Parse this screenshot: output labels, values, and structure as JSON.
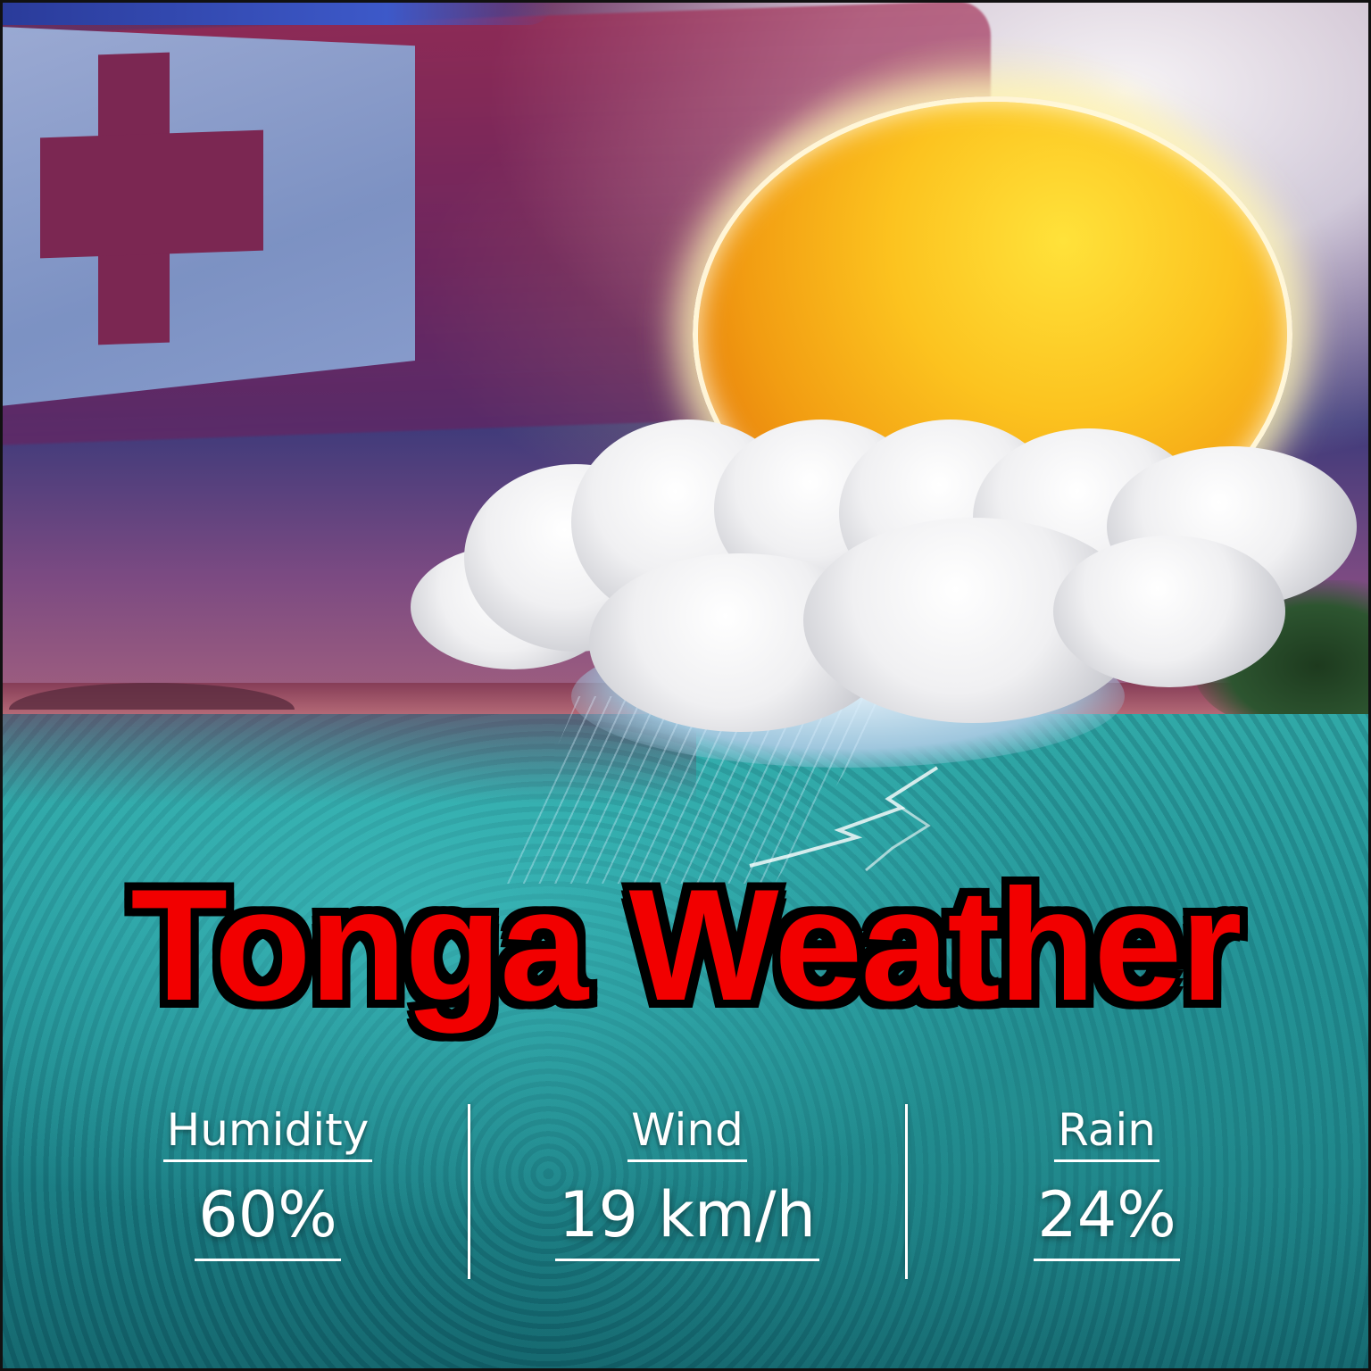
{
  "title": "Tonga Weather",
  "stats": [
    {
      "label": "Humidity",
      "value": "60%"
    },
    {
      "label": "Wind",
      "value": "19 km/h"
    },
    {
      "label": "Rain",
      "value": "24%"
    }
  ],
  "colors": {
    "title_fill": "#f20000",
    "title_outline": "#ffffff",
    "title_shadow": "#000000",
    "stat_text": "#ffffff",
    "flag_red": "#7b2752",
    "flag_canton": "#8ba3d2",
    "sun": "#f29d12",
    "sea": "#1f8f93"
  },
  "icons": {
    "weather": "sun-behind-rain-cloud-icon",
    "flag": "tonga-flag"
  }
}
